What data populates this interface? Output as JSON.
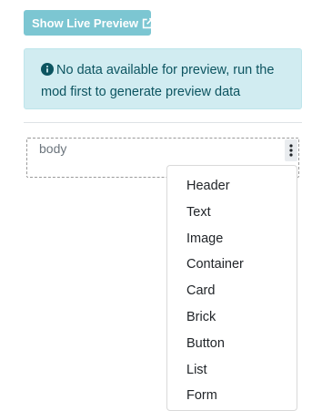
{
  "toolbar": {
    "preview_button_label": "Show Live Preview",
    "preview_icon": "external-link-icon"
  },
  "alert": {
    "icon": "info-circle-icon",
    "message": "No data available for preview, run the mod first to generate preview data"
  },
  "canvas": {
    "body_label": "body",
    "menu_icon": "kebab-menu-icon"
  },
  "dropdown": {
    "items": [
      "Header",
      "Text",
      "Image",
      "Container",
      "Card",
      "Brick",
      "Button",
      "List",
      "Form"
    ]
  },
  "colors": {
    "button_bg": "#7cc6d2",
    "alert_bg": "#d1ecf1",
    "alert_text": "#0c5460"
  }
}
